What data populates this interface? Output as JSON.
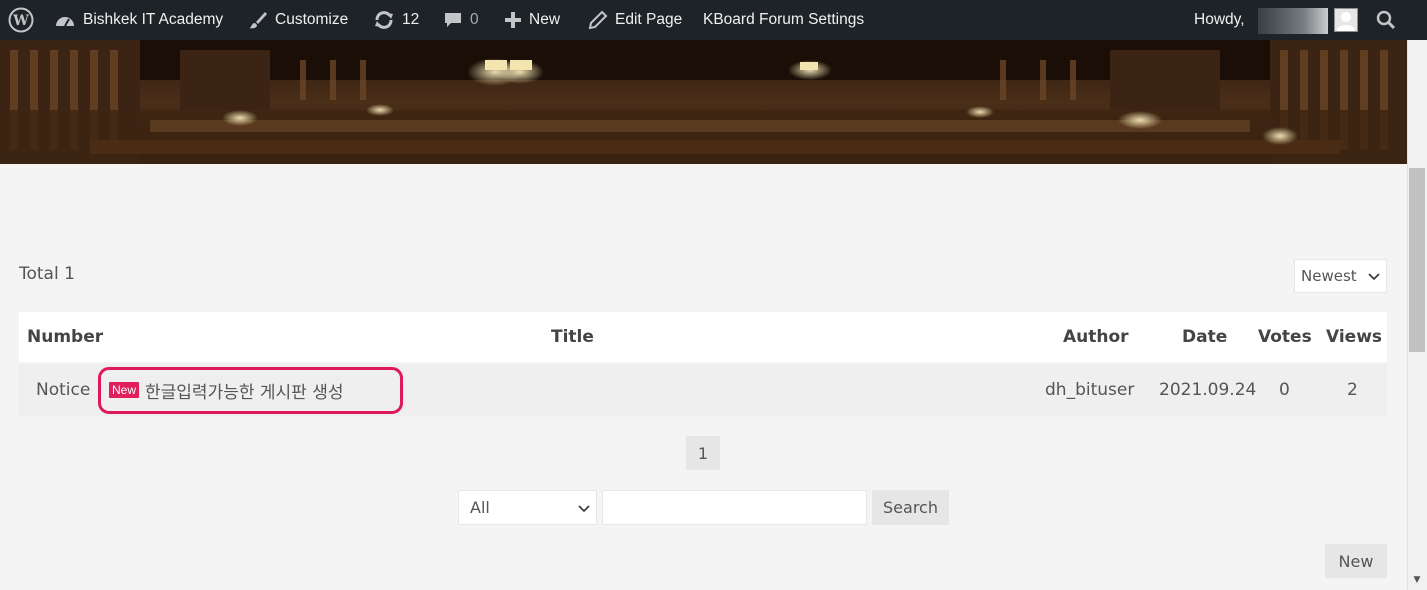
{
  "adminbar": {
    "site_name": "Bishkek IT Academy",
    "customize": "Customize",
    "updates_count": "12",
    "comments_count": "0",
    "new_label": "New",
    "edit_page": "Edit Page",
    "kboard_settings": "KBoard Forum Settings",
    "howdy": "Howdy, "
  },
  "board": {
    "total_label": "Total 1",
    "sort_selected": "Newest",
    "columns": {
      "number": "Number",
      "title": "Title",
      "author": "Author",
      "date": "Date",
      "votes": "Votes",
      "views": "Views"
    },
    "rows": [
      {
        "number": "Notice",
        "badge": "New",
        "title": "한글입력가능한 게시판 생성",
        "author": "dh_bituser",
        "date": "2021.09.24",
        "votes": "0",
        "views": "2"
      }
    ],
    "pagination": {
      "current": "1"
    },
    "search": {
      "field_selected": "All",
      "input_value": "",
      "button": "Search"
    },
    "new_button": "New"
  },
  "colors": {
    "adminbar_bg": "#1d2327",
    "badge": "#e0205a",
    "highlight": "#e0185c",
    "page_bg": "#f4f4f4"
  }
}
